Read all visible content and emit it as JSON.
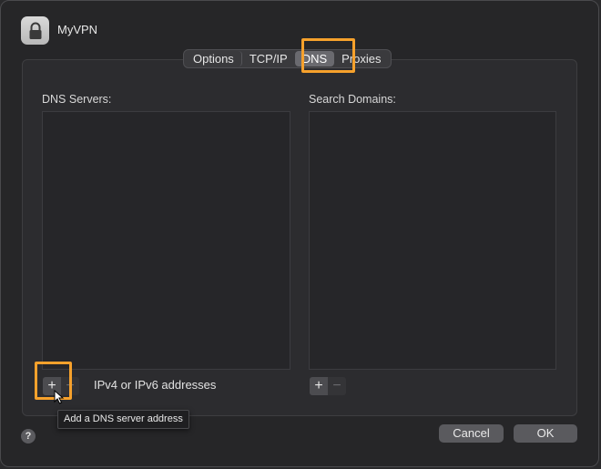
{
  "window": {
    "title": "MyVPN"
  },
  "tabs": [
    {
      "label": "Options"
    },
    {
      "label": "TCP/IP"
    },
    {
      "label": "DNS",
      "active": true
    },
    {
      "label": "Proxies"
    }
  ],
  "dns": {
    "label": "DNS Servers:",
    "add_label": "+",
    "remove_label": "−",
    "hint": "IPv4 or IPv6 addresses",
    "tooltip": "Add a DNS server address",
    "entries": []
  },
  "search": {
    "label": "Search Domains:",
    "add_label": "+",
    "remove_label": "−",
    "entries": []
  },
  "footer": {
    "help_label": "?",
    "cancel_label": "Cancel",
    "ok_label": "OK"
  },
  "colors": {
    "highlight": "#f6a12c"
  },
  "icons": {
    "app": "lock-icon",
    "pointer": "cursor-icon"
  }
}
